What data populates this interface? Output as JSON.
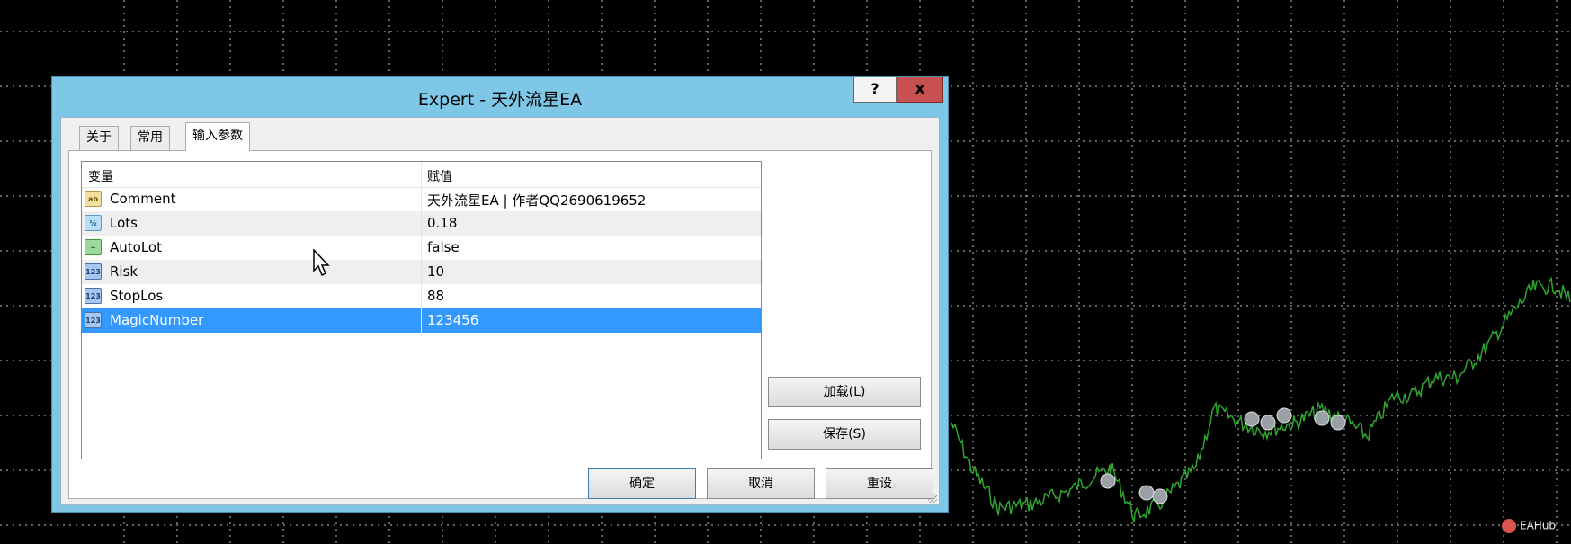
{
  "dialog": {
    "title": "Expert - 天外流星EA",
    "help_label": "?",
    "close_label": "x",
    "tabs": [
      {
        "label": "关于",
        "active": false
      },
      {
        "label": "常用",
        "active": false
      },
      {
        "label": "输入参数",
        "active": true
      }
    ],
    "grid": {
      "headers": {
        "variable": "变量",
        "value": "赋值"
      },
      "rows": [
        {
          "icon": "text-icon",
          "name": "Comment",
          "value": "天外流星EA | 作者QQ2690619652",
          "selected": false
        },
        {
          "icon": "fraction-icon",
          "name": "Lots",
          "value": "0.18",
          "selected": false
        },
        {
          "icon": "bool-icon",
          "name": "AutoLot",
          "value": "false",
          "selected": false
        },
        {
          "icon": "integer-icon",
          "name": "Risk",
          "value": "10",
          "selected": false
        },
        {
          "icon": "integer-icon",
          "name": "StopLos",
          "value": "88",
          "selected": false
        },
        {
          "icon": "integer-icon",
          "name": "MagicNumber",
          "value": "123456",
          "selected": true
        }
      ]
    },
    "buttons": {
      "load": "加载(L)",
      "save": "保存(S)",
      "ok": "确定",
      "cancel": "取消",
      "reset": "重设"
    }
  },
  "watermark": {
    "text": "EAHub"
  },
  "colors": {
    "chart_bg": "#000000",
    "grid_line": "#ffffff",
    "price_line": "#2fa52f",
    "dialog_frame": "#7ec7e6",
    "selection": "#3399ff",
    "close_button": "#c75050"
  }
}
